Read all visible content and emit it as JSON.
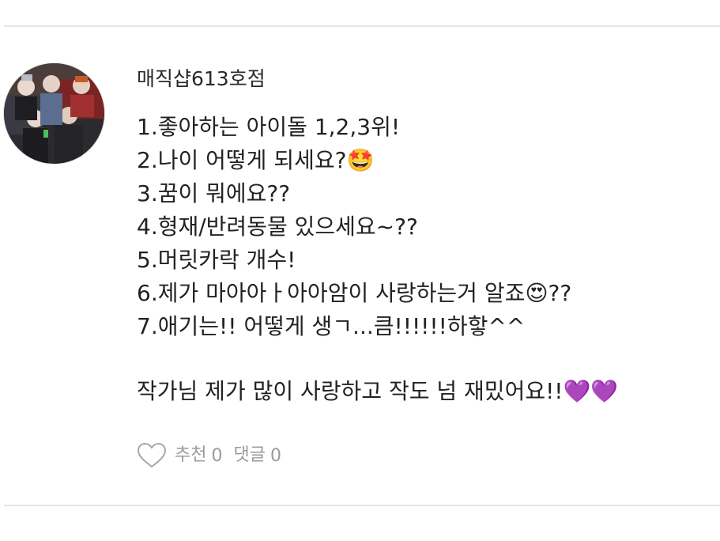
{
  "comment": {
    "username": "매직샵613호점",
    "lines": [
      "1.좋아하는 아이돌 1,2,3위!",
      "2.나이 어떻게 되세요?🤩",
      "3.꿈이 뭐에요??",
      "4.형재/반려동물 있으세요~??",
      "5.머릿카락 개수!",
      "6.제가 마아아ㅏ아아암이 사랑하는거 알죠😍??",
      "7.애기는!! 어떻게 생ㄱ...큼!!!!!!하핳^^"
    ],
    "closing": "작가님 제가 많이 사랑하고 작도 넘 재밌어요!!💜💜",
    "actions": {
      "recommend_label": "추천",
      "recommend_count": "0",
      "reply_label": "댓글",
      "reply_count": "0"
    }
  },
  "icons": {
    "like": "heart-outline-icon",
    "avatar": "profile-photo"
  },
  "colors": {
    "divider": "#e6e6e6",
    "text": "#222222",
    "muted": "#9a9a9a"
  }
}
